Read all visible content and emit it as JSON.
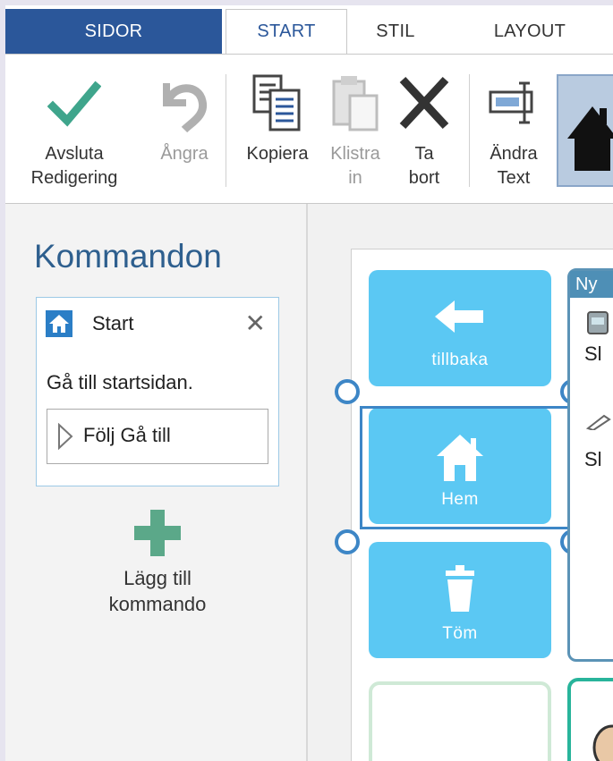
{
  "tabs": [
    {
      "label": "SIDOR"
    },
    {
      "label": "START"
    },
    {
      "label": "STIL"
    },
    {
      "label": "LAYOUT"
    }
  ],
  "ribbon": {
    "finish_editing": {
      "line1": "Avsluta",
      "line2": "Redigering",
      "icon": "checkmark-icon"
    },
    "undo": {
      "line1": "Ångra",
      "icon": "undo-icon"
    },
    "copy": {
      "line1": "Kopiera",
      "icon": "copy-icon"
    },
    "paste": {
      "line1": "Klistra",
      "line2": "in",
      "icon": "paste-icon"
    },
    "delete": {
      "line1": "Ta",
      "line2": "bort",
      "icon": "delete-icon"
    },
    "edit_text": {
      "line1": "Ändra",
      "line2": "Text",
      "icon": "edit-text-icon"
    }
  },
  "commands_panel": {
    "title": "Kommandon",
    "card": {
      "name": "Start",
      "description": "Gå till startsidan.",
      "link_label": "Följ Gå till"
    },
    "add_line1": "Lägg till",
    "add_line2": "kommando"
  },
  "board": {
    "cells": [
      {
        "label": "tillbaka",
        "icon": "arrow-left-icon"
      },
      {
        "label": "Hem",
        "icon": "home-icon"
      },
      {
        "label": "Töm",
        "icon": "trash-icon"
      }
    ],
    "group": {
      "header": "Ny",
      "items": [
        "Sl",
        "Sl"
      ]
    }
  },
  "colors": {
    "accent": "#2b579a",
    "cell": "#5bc8f3",
    "selection": "#3d86c6",
    "check": "#3fa58c",
    "add": "#5ba889"
  }
}
